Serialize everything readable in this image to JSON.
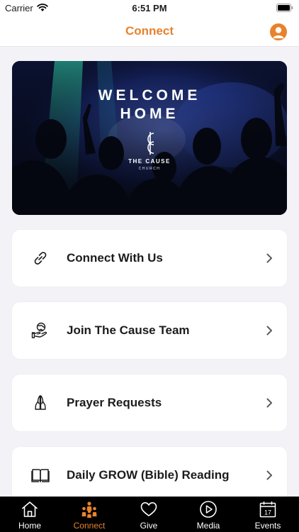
{
  "status_bar": {
    "carrier": "Carrier",
    "time": "6:51 PM",
    "wifi_icon": "wifi-icon",
    "battery_icon": "battery-icon"
  },
  "header": {
    "title": "Connect",
    "profile_icon": "person-icon"
  },
  "banner": {
    "line1": "WELCOME",
    "line2": "HOME",
    "brand": "THE CAUSE",
    "brand_sub": "CHURCH"
  },
  "cards": [
    {
      "label": "Connect With Us",
      "icon": "link-icon"
    },
    {
      "label": "Join The Cause Team",
      "icon": "hand-globe-icon"
    },
    {
      "label": "Prayer Requests",
      "icon": "praying-hands-icon"
    },
    {
      "label": "Daily GROW (Bible) Reading",
      "icon": "open-book-icon"
    }
  ],
  "tabs": [
    {
      "label": "Home",
      "icon": "home-icon",
      "active": false
    },
    {
      "label": "Connect",
      "icon": "group-icon",
      "active": true
    },
    {
      "label": "Give",
      "icon": "heart-icon",
      "active": false
    },
    {
      "label": "Media",
      "icon": "play-icon",
      "active": false
    },
    {
      "label": "Events",
      "icon": "calendar-icon",
      "active": false,
      "calendar_day": "17"
    }
  ],
  "colors": {
    "accent": "#e8822c",
    "background": "#f2f2f7",
    "card": "#ffffff",
    "tab_bar": "#000000"
  }
}
